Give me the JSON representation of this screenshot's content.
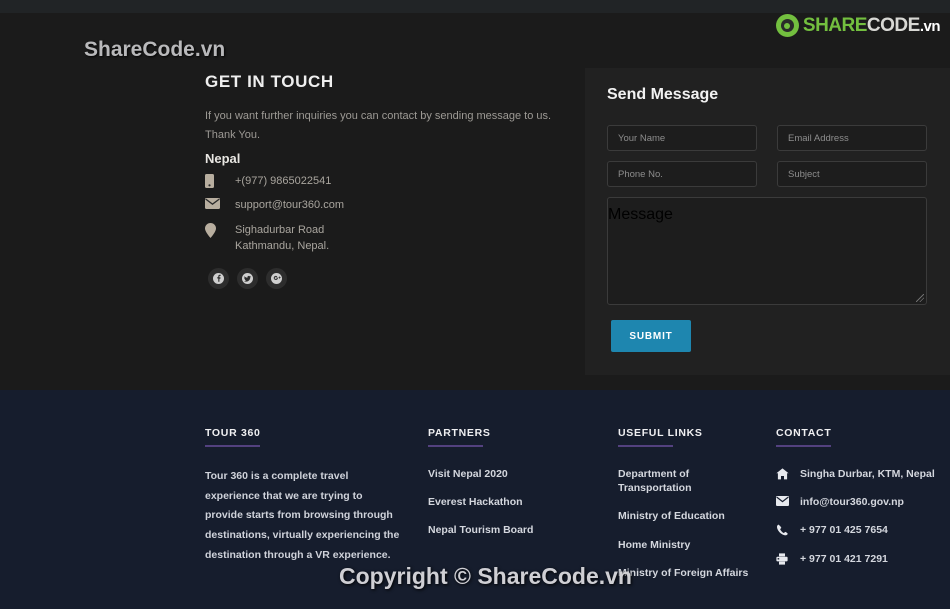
{
  "brand": {
    "part1": "SHARE",
    "part2": "CODE",
    "part3": ".vn",
    "mark_icon": "recycle-circle-icon"
  },
  "watermarks": {
    "top": "ShareCode.vn",
    "bottom": "Copyright © ShareCode.vn"
  },
  "contact": {
    "title": "GET IN TOUCH",
    "description": "If you want further inquiries you can contact by sending message to us. Thank You.",
    "country": "Nepal",
    "phone": "+(977) 9865022541",
    "email": "support@tour360.com",
    "address_line1": "Sighadurbar Road",
    "address_line2": "Kathmandu, Nepal.",
    "icons": {
      "phone": "mobile-phone-icon",
      "email": "envelope-icon",
      "address": "map-pin-icon"
    },
    "social": [
      {
        "name": "facebook-icon",
        "glyph": "f"
      },
      {
        "name": "twitter-icon",
        "glyph": "t"
      },
      {
        "name": "google-plus-icon",
        "glyph": "g"
      }
    ]
  },
  "form": {
    "title": "Send Message",
    "fields": [
      {
        "name": "your-name",
        "placeholder": "Your Name",
        "value": ""
      },
      {
        "name": "email-address",
        "placeholder": "Email Address",
        "value": ""
      },
      {
        "name": "phone-no",
        "placeholder": "Phone No.",
        "value": ""
      },
      {
        "name": "subject",
        "placeholder": "Subject",
        "value": ""
      }
    ],
    "message_placeholder": "Message",
    "message_value": "",
    "submit_label": "SUBMIT",
    "submit_color": "#1e86af"
  },
  "footer": {
    "accent_rule_color": "#53417f",
    "background": "#161d2d",
    "columns": [
      {
        "heading": "TOUR 360",
        "description": "Tour 360 is a complete travel experience that we are trying to provide starts from browsing through destinations, virtually experiencing the destination through a VR experience."
      },
      {
        "heading": "PARTNERS",
        "links": [
          "Visit Nepal 2020",
          "Everest Hackathon",
          "Nepal Tourism Board"
        ]
      },
      {
        "heading": "USEFUL LINKS",
        "links": [
          "Department of Transportation",
          "Ministry of Education",
          "Home Ministry",
          "Ministry of Foreign Affairs"
        ]
      },
      {
        "heading": "CONTACT",
        "items": [
          {
            "icon": "home-icon",
            "text": "Singha Durbar, KTM, Nepal"
          },
          {
            "icon": "envelope-icon",
            "text": "info@tour360.gov.np"
          },
          {
            "icon": "phone-icon",
            "text": "+ 977 01 425 7654"
          },
          {
            "icon": "fax-icon",
            "text": "+ 977 01 421 7291"
          }
        ]
      }
    ]
  }
}
